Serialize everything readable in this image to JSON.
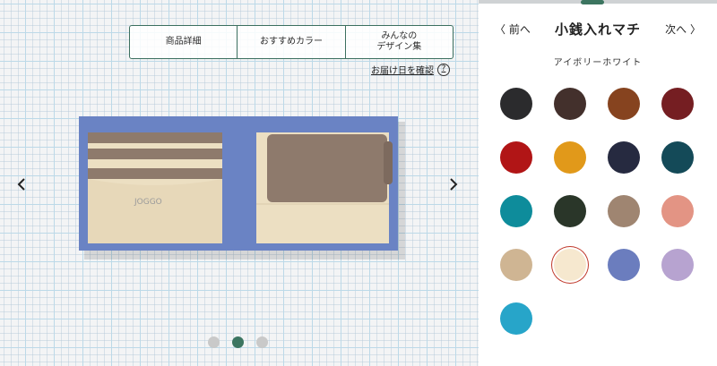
{
  "tabs": [
    {
      "label": "商品詳細"
    },
    {
      "label": "おすすめカラー"
    },
    {
      "label": "みんなの\nデザイン集"
    }
  ],
  "delivery_link": "お届け日を確認",
  "help_symbol": "?",
  "wallet": {
    "brand": "JOGGO",
    "body_color": "#6a83c4",
    "inner_color": "#ecdfc2",
    "pocket_color": "#8e7a6c"
  },
  "carousel": {
    "current": 2,
    "total": 3
  },
  "panel": {
    "prev_label": "前へ",
    "next_label": "次へ",
    "title": "小銭入れマチ",
    "selected_color_name": "アイボリーホワイト"
  },
  "colors": [
    "#2b2b2d",
    "#43302c",
    "#86431f",
    "#751e22",
    "#b11516",
    "#e1991a",
    "#262a40",
    "#144a58",
    "#0e8c9b",
    "#2a3629",
    "#9f8571",
    "#e39484",
    "#cfb593",
    "#f6e8cf",
    "#6b7dbe",
    "#b7a3d0",
    "#27a5c9"
  ],
  "selected_index": 13
}
